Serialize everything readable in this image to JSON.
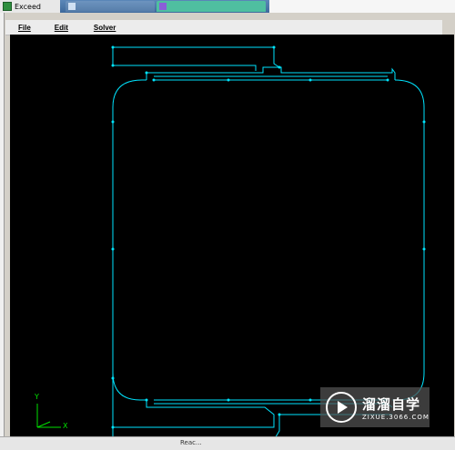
{
  "window": {
    "title": "Exceed",
    "background_tabs": [
      "",
      ""
    ]
  },
  "menu": {
    "items": [
      "File",
      "Edit",
      "Solver"
    ]
  },
  "canvas": {
    "background": "#000000",
    "line_color": "#00e5ff",
    "axis_labels": {
      "x": "X",
      "y": "Y"
    }
  },
  "watermark": {
    "main": "溜溜自学",
    "sub": "ZIXUE.3066.COM"
  },
  "statusbar": {
    "caption": "Reac..."
  }
}
